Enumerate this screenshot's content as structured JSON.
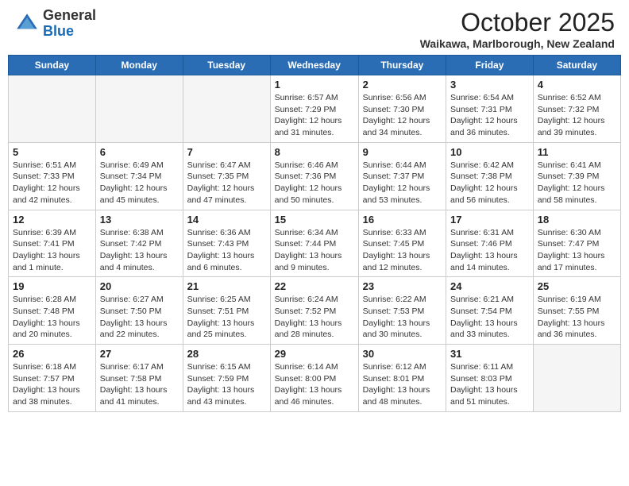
{
  "header": {
    "logo_general": "General",
    "logo_blue": "Blue",
    "month_title": "October 2025",
    "location": "Waikawa, Marlborough, New Zealand"
  },
  "days_of_week": [
    "Sunday",
    "Monday",
    "Tuesday",
    "Wednesday",
    "Thursday",
    "Friday",
    "Saturday"
  ],
  "weeks": [
    [
      {
        "day": "",
        "info": ""
      },
      {
        "day": "",
        "info": ""
      },
      {
        "day": "",
        "info": ""
      },
      {
        "day": "1",
        "info": "Sunrise: 6:57 AM\nSunset: 7:29 PM\nDaylight: 12 hours and 31 minutes."
      },
      {
        "day": "2",
        "info": "Sunrise: 6:56 AM\nSunset: 7:30 PM\nDaylight: 12 hours and 34 minutes."
      },
      {
        "day": "3",
        "info": "Sunrise: 6:54 AM\nSunset: 7:31 PM\nDaylight: 12 hours and 36 minutes."
      },
      {
        "day": "4",
        "info": "Sunrise: 6:52 AM\nSunset: 7:32 PM\nDaylight: 12 hours and 39 minutes."
      }
    ],
    [
      {
        "day": "5",
        "info": "Sunrise: 6:51 AM\nSunset: 7:33 PM\nDaylight: 12 hours and 42 minutes."
      },
      {
        "day": "6",
        "info": "Sunrise: 6:49 AM\nSunset: 7:34 PM\nDaylight: 12 hours and 45 minutes."
      },
      {
        "day": "7",
        "info": "Sunrise: 6:47 AM\nSunset: 7:35 PM\nDaylight: 12 hours and 47 minutes."
      },
      {
        "day": "8",
        "info": "Sunrise: 6:46 AM\nSunset: 7:36 PM\nDaylight: 12 hours and 50 minutes."
      },
      {
        "day": "9",
        "info": "Sunrise: 6:44 AM\nSunset: 7:37 PM\nDaylight: 12 hours and 53 minutes."
      },
      {
        "day": "10",
        "info": "Sunrise: 6:42 AM\nSunset: 7:38 PM\nDaylight: 12 hours and 56 minutes."
      },
      {
        "day": "11",
        "info": "Sunrise: 6:41 AM\nSunset: 7:39 PM\nDaylight: 12 hours and 58 minutes."
      }
    ],
    [
      {
        "day": "12",
        "info": "Sunrise: 6:39 AM\nSunset: 7:41 PM\nDaylight: 13 hours and 1 minute."
      },
      {
        "day": "13",
        "info": "Sunrise: 6:38 AM\nSunset: 7:42 PM\nDaylight: 13 hours and 4 minutes."
      },
      {
        "day": "14",
        "info": "Sunrise: 6:36 AM\nSunset: 7:43 PM\nDaylight: 13 hours and 6 minutes."
      },
      {
        "day": "15",
        "info": "Sunrise: 6:34 AM\nSunset: 7:44 PM\nDaylight: 13 hours and 9 minutes."
      },
      {
        "day": "16",
        "info": "Sunrise: 6:33 AM\nSunset: 7:45 PM\nDaylight: 13 hours and 12 minutes."
      },
      {
        "day": "17",
        "info": "Sunrise: 6:31 AM\nSunset: 7:46 PM\nDaylight: 13 hours and 14 minutes."
      },
      {
        "day": "18",
        "info": "Sunrise: 6:30 AM\nSunset: 7:47 PM\nDaylight: 13 hours and 17 minutes."
      }
    ],
    [
      {
        "day": "19",
        "info": "Sunrise: 6:28 AM\nSunset: 7:48 PM\nDaylight: 13 hours and 20 minutes."
      },
      {
        "day": "20",
        "info": "Sunrise: 6:27 AM\nSunset: 7:50 PM\nDaylight: 13 hours and 22 minutes."
      },
      {
        "day": "21",
        "info": "Sunrise: 6:25 AM\nSunset: 7:51 PM\nDaylight: 13 hours and 25 minutes."
      },
      {
        "day": "22",
        "info": "Sunrise: 6:24 AM\nSunset: 7:52 PM\nDaylight: 13 hours and 28 minutes."
      },
      {
        "day": "23",
        "info": "Sunrise: 6:22 AM\nSunset: 7:53 PM\nDaylight: 13 hours and 30 minutes."
      },
      {
        "day": "24",
        "info": "Sunrise: 6:21 AM\nSunset: 7:54 PM\nDaylight: 13 hours and 33 minutes."
      },
      {
        "day": "25",
        "info": "Sunrise: 6:19 AM\nSunset: 7:55 PM\nDaylight: 13 hours and 36 minutes."
      }
    ],
    [
      {
        "day": "26",
        "info": "Sunrise: 6:18 AM\nSunset: 7:57 PM\nDaylight: 13 hours and 38 minutes."
      },
      {
        "day": "27",
        "info": "Sunrise: 6:17 AM\nSunset: 7:58 PM\nDaylight: 13 hours and 41 minutes."
      },
      {
        "day": "28",
        "info": "Sunrise: 6:15 AM\nSunset: 7:59 PM\nDaylight: 13 hours and 43 minutes."
      },
      {
        "day": "29",
        "info": "Sunrise: 6:14 AM\nSunset: 8:00 PM\nDaylight: 13 hours and 46 minutes."
      },
      {
        "day": "30",
        "info": "Sunrise: 6:12 AM\nSunset: 8:01 PM\nDaylight: 13 hours and 48 minutes."
      },
      {
        "day": "31",
        "info": "Sunrise: 6:11 AM\nSunset: 8:03 PM\nDaylight: 13 hours and 51 minutes."
      },
      {
        "day": "",
        "info": ""
      }
    ]
  ]
}
